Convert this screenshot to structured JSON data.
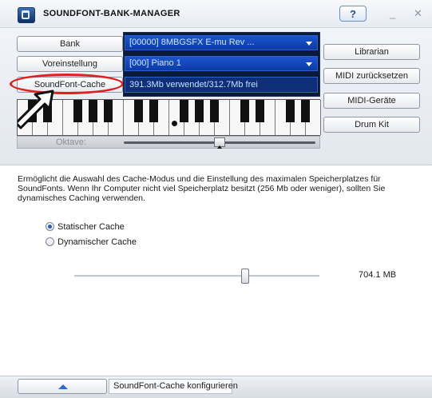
{
  "window": {
    "title": "SOUNDFONT-BANK-MANAGER",
    "help_label": "?",
    "minimize_label": "_",
    "close_label": "✕"
  },
  "left_buttons": {
    "bank": "Bank",
    "preset": "Voreinstellung",
    "cache": "SoundFont-Cache"
  },
  "display": {
    "bank_select": "[00000] 8MBGSFX E-mu Rev ...",
    "preset_select": "[000] Piano 1",
    "cache_status": "391.3Mb verwendet/312.7Mb frei"
  },
  "right_buttons": {
    "librarian": "Librarian",
    "midi_reset": "MIDI zurücksetzen",
    "midi_devices": "MIDI-Geräte",
    "drum_kit": "Drum Kit"
  },
  "keyboard": {
    "octave_label": "Oktave:"
  },
  "description": "Ermöglicht die Auswahl des Cache-Modus und die Einstellung des maximalen Speicherplatzes für SoundFonts. Wenn Ihr Computer nicht viel Speicherplatz besitzt (256 Mb oder weniger), sollten Sie dynamisches Caching verwenden.",
  "cache_mode": {
    "static_label": "Statischer Cache",
    "dynamic_label": "Dynamischer Cache",
    "selected": "static"
  },
  "cache_size": {
    "value_label": "704.1 MB"
  },
  "footer": {
    "status": "SoundFont-Cache konfigurieren"
  },
  "colors": {
    "annotation": "#e02020",
    "display_bg": "#0a1a3a",
    "select_bg": "#1c55d0"
  }
}
